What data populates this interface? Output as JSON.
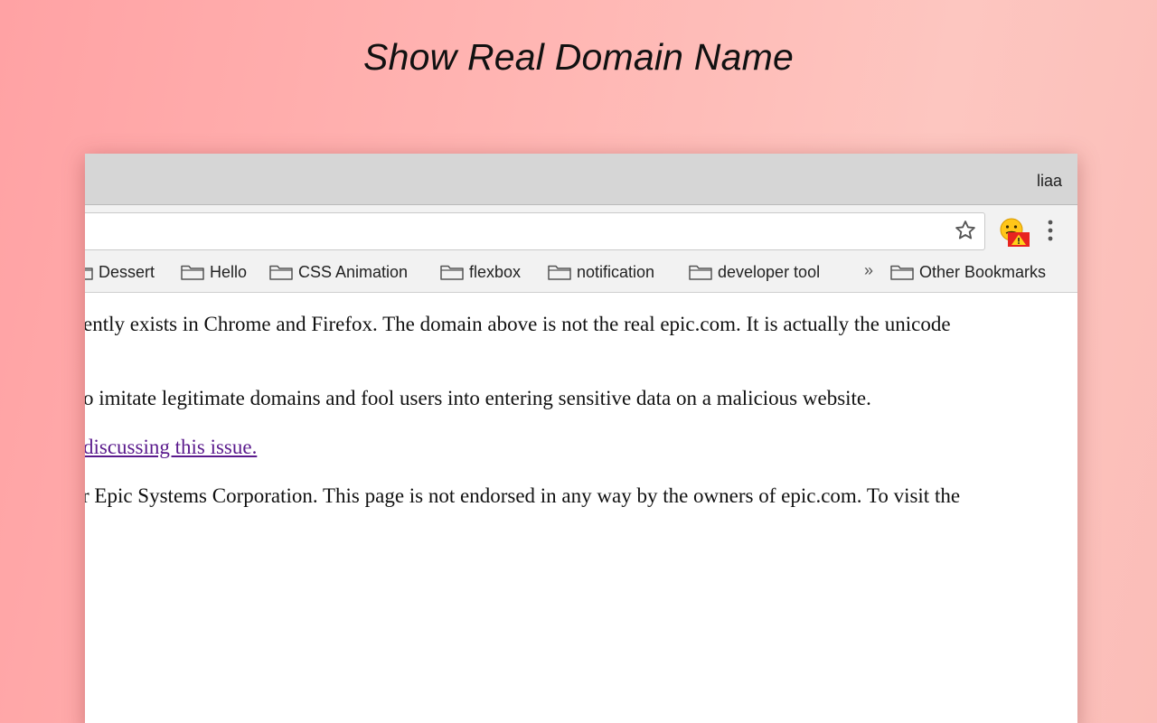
{
  "headline": "Show Real Domain Name",
  "browser": {
    "profile_name": "liaa",
    "bookmarks": [
      "Dessert",
      "Hello",
      "CSS Animation",
      "flexbox",
      "notification",
      "developer tool"
    ],
    "overflow_chevron": "»",
    "other_bookmarks": "Other Bookmarks"
  },
  "page": {
    "para1": "ently exists in Chrome and Firefox. The domain above is not the real epic.com. It is actually the unicode",
    "para2": "o imitate legitimate domains and fool users into entering sensitive data on a malicious website.",
    "link": "discussing this issue.",
    "para3": "r Epic Systems Corporation. This page is not endorsed in any way by the owners of epic.com. To visit the"
  },
  "colors": {
    "link_visited": "#5a1a8c",
    "warning_red": "#e8231f",
    "emoji_yellow": "#ffc619"
  }
}
